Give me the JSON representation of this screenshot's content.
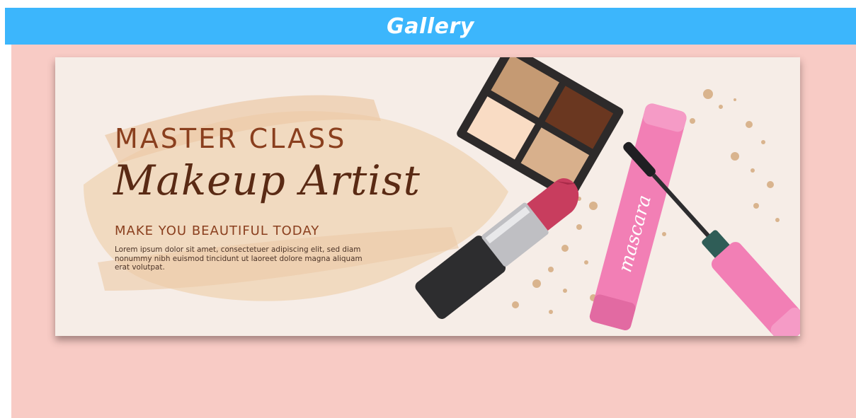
{
  "header": {
    "title": "Gallery"
  },
  "banner": {
    "heading": "MASTER CLASS",
    "script_title": "Makeup Artist",
    "tagline": "MAKE YOU BEAUTIFUL TODAY",
    "body": "Lorem ipsum dolor sit amet, consectetuer adipiscing elit, sed diam nonummy nibh euismod tincidunt ut laoreet dolore magna aliquam erat volutpat.",
    "mascara_label": "mascara"
  },
  "colors": {
    "header_bg": "#3cb6fc",
    "panel_bg": "#f8cbc5",
    "banner_bg": "#f6ede7",
    "heading_brown": "#8a3f1e",
    "script_brown": "#5a2a14",
    "lipstick": "#c83d5e",
    "mascara_pink": "#f27fb5"
  },
  "icons": [
    "palette-illustration",
    "lipstick-illustration",
    "mascara-illustration",
    "mascara-wand-illustration",
    "paint-splatter"
  ]
}
